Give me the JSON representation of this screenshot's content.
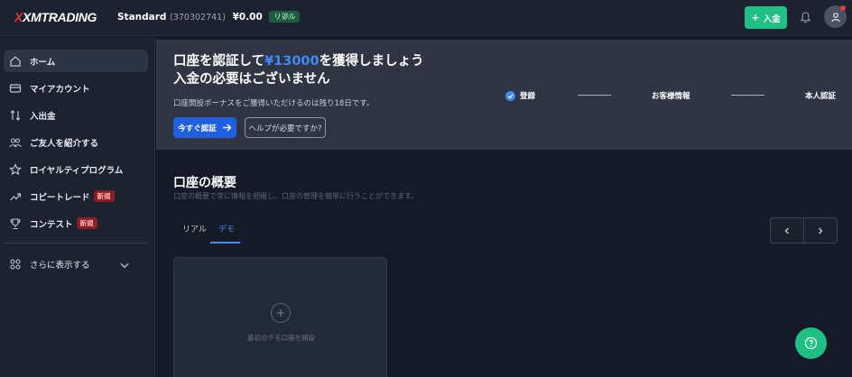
{
  "header": {
    "logo_text": "XMTRADING",
    "account_type": "Standard",
    "account_number": "(370302741)",
    "balance": "¥0.00",
    "account_badge": "リアル",
    "deposit_label": "入金",
    "accent_color": "#1fbf86"
  },
  "sidebar": {
    "items": [
      {
        "label": "ホーム",
        "icon": "home-icon"
      },
      {
        "label": "マイアカウント",
        "icon": "wallet-icon"
      },
      {
        "label": "入出金",
        "icon": "transfer-arrows-icon"
      },
      {
        "label": "ご友人を紹介する",
        "icon": "friends-icon"
      },
      {
        "label": "ロイヤルティプログラム",
        "icon": "star-icon"
      },
      {
        "label": "コピートレード",
        "icon": "trend-up-icon",
        "badge": "新規"
      },
      {
        "label": "コンテスト",
        "icon": "trophy-icon",
        "badge": "新規"
      }
    ],
    "more_label": "さらに表示する"
  },
  "banner": {
    "title_prefix": "口座を認証して",
    "title_highlight": "¥13000",
    "title_suffix": "を獲得しましょう",
    "title_line2": "入金の必要はございません",
    "subtitle": "口座開設ボーナスをご獲得いただけるのは残り18日です。",
    "verify_button": "今すぐ認証",
    "help_button": "ヘルプが必要ですか?",
    "steps": [
      "登録",
      "お客様情報",
      "本人認証"
    ]
  },
  "main": {
    "title": "口座の概要",
    "description": "口座の概要で常に情報を把握し、口座の管理を簡単に行うことができます。",
    "tabs": [
      "リアル",
      "デモ"
    ],
    "active_tab": "デモ",
    "card_label": "最初のデモ口座を開設"
  }
}
